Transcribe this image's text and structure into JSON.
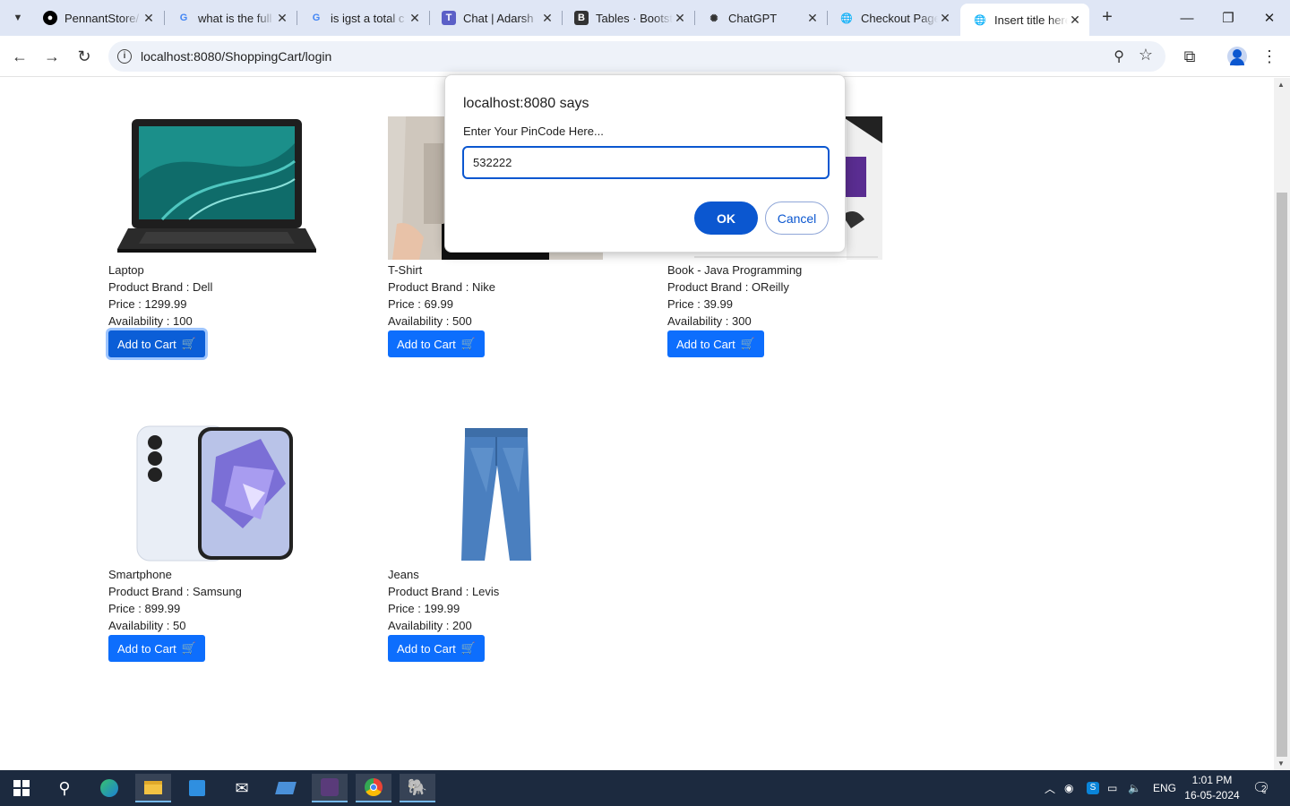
{
  "browser": {
    "tabs": [
      {
        "title": "PennantStore/",
        "icon": "github-icon"
      },
      {
        "title": "what is the full",
        "icon": "google-icon"
      },
      {
        "title": "is igst a total c",
        "icon": "google-icon"
      },
      {
        "title": "Chat | Adarsh",
        "icon": "teams-icon"
      },
      {
        "title": "Tables · Bootst",
        "icon": "bootstrap-icon"
      },
      {
        "title": "ChatGPT",
        "icon": "chatgpt-icon"
      },
      {
        "title": "Checkout Page",
        "icon": "globe-icon"
      },
      {
        "title": "Insert title here",
        "icon": "globe-icon",
        "active": true
      }
    ],
    "url": "localhost:8080/ShoppingCart/login"
  },
  "dialog": {
    "title": "localhost:8080 says",
    "message": "Enter Your PinCode Here...",
    "input_value": "532222",
    "ok_label": "OK",
    "cancel_label": "Cancel"
  },
  "products": [
    {
      "name": "Laptop",
      "brand": "Product Brand : Dell",
      "price": "Price : 1299.99",
      "availability": "Availability : 100",
      "button": "Add to Cart"
    },
    {
      "name": "T-Shirt",
      "brand": "Product Brand : Nike",
      "price": "Price : 69.99",
      "availability": "Availability : 500",
      "button": "Add to Cart"
    },
    {
      "name": "Book - Java Programming",
      "brand": "Product Brand : OReilly",
      "price": "Price : 39.99",
      "availability": "Availability : 300",
      "button": "Add to Cart"
    },
    {
      "name": "Smartphone",
      "brand": "Product Brand : Samsung",
      "price": "Price : 899.99",
      "availability": "Availability : 50",
      "button": "Add to Cart"
    },
    {
      "name": "Jeans",
      "brand": "Product Brand : Levis",
      "price": "Price : 199.99",
      "availability": "Availability : 200",
      "button": "Add to Cart"
    }
  ],
  "taskbar": {
    "language": "ENG",
    "time": "1:01 PM",
    "date": "16-05-2024",
    "notifications": "2"
  },
  "colors": {
    "primary_button": "#0d6efd",
    "dialog_accent": "#0b57d0",
    "tabstrip": "#dfe6f5",
    "taskbar": "#1c2a3f"
  }
}
